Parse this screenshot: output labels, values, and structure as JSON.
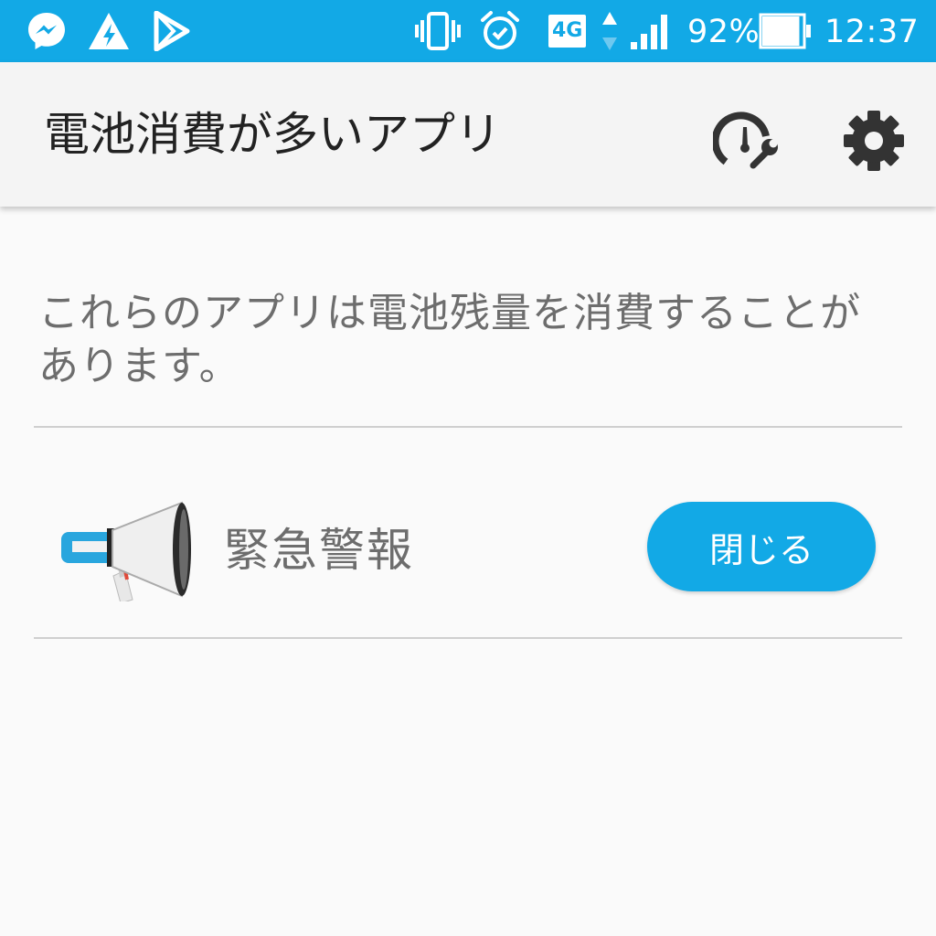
{
  "status_bar": {
    "left_icons": [
      "messenger-icon",
      "lightning-triangle-icon",
      "play-store-icon"
    ],
    "network_label": "4G",
    "battery_percent": "92%",
    "battery_level": 0.92,
    "time": "12:37",
    "background_color": "#12a9e6"
  },
  "app_bar": {
    "title": "電池消費が多いアプリ",
    "actions": [
      "speedometer-wrench-icon",
      "gear-icon"
    ]
  },
  "description": "これらのアプリは電池残量を消費することがあります。",
  "apps": [
    {
      "name": "緊急警報",
      "icon": "megaphone-icon",
      "action_label": "閉じる"
    }
  ],
  "colors": {
    "accent": "#12a9e6",
    "text_primary": "#222222",
    "text_secondary": "#6d6d6d",
    "background": "#fafafa"
  }
}
